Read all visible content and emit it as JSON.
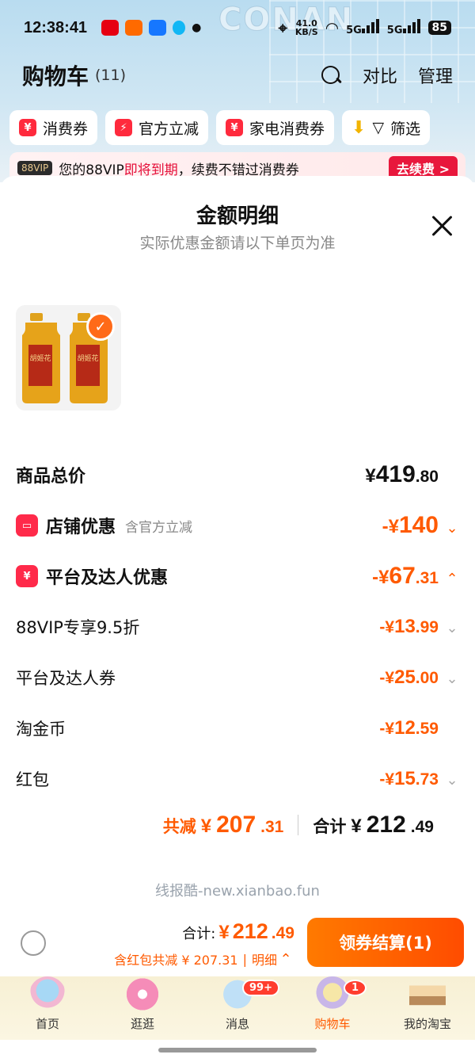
{
  "status_bar": {
    "time": "12:38:41",
    "net_speed_value": "41.0",
    "net_speed_unit": "KB/S",
    "signal_1": "5G",
    "signal_2": "5G",
    "battery": "85"
  },
  "header": {
    "title": "购物车",
    "count": "(11)",
    "compare_label": "对比",
    "manage_label": "管理",
    "decor_text": "CONAN"
  },
  "filters": [
    {
      "label": "消费券",
      "icon": "coupon-icon",
      "icon_glyph": "¥"
    },
    {
      "label": "官方立减",
      "icon": "lightning-icon",
      "icon_glyph": "⚡"
    },
    {
      "label": "家电消费券",
      "icon": "coupon-icon",
      "icon_glyph": "¥"
    },
    {
      "label": "筛选",
      "icon": "filter-icon",
      "icon_glyph": "▽"
    }
  ],
  "vip_banner": {
    "badge": "88VIP",
    "text_prefix": "您的88VIP",
    "text_highlight": "即将到期",
    "text_suffix": "，续费不错过消费券",
    "button": "去续费 >"
  },
  "sheet": {
    "title": "金额明细",
    "subtitle": "实际优惠金额请以下单页为准",
    "product_brand": "胡姬花"
  },
  "breakdown": {
    "total": {
      "label": "商品总价",
      "currency": "¥",
      "int": "419",
      "dec": ".80"
    },
    "store": {
      "label": "店铺优惠",
      "note": "含官方立减",
      "prefix": "-¥",
      "int": "140",
      "dec": ""
    },
    "platform": {
      "label": "平台及达人优惠",
      "prefix": "-¥",
      "int": "67",
      "dec": ".31"
    },
    "items": [
      {
        "label": "88VIP专享9.5折",
        "prefix": "-¥",
        "int": "13",
        "dec": ".99",
        "expandable": true
      },
      {
        "label": "平台及达人券",
        "prefix": "-¥",
        "int": "25",
        "dec": ".00",
        "expandable": true
      },
      {
        "label": "淘金币",
        "prefix": "-¥",
        "int": "12",
        "dec": ".59",
        "expandable": false
      },
      {
        "label": "红包",
        "prefix": "-¥",
        "int": "15",
        "dec": ".73",
        "expandable": true
      }
    ],
    "saved": {
      "label": "共减",
      "currency": "¥",
      "int": "207",
      "dec": ".31"
    },
    "sum": {
      "label": "合计",
      "currency": "¥",
      "int": "212",
      "dec": ".49"
    }
  },
  "watermark": "线报酷-new.xianbao.fun",
  "checkout": {
    "total_label": "合计:",
    "currency": "¥",
    "int": "212",
    "dec": ".49",
    "sub_text": "含红包共减 ¥ 207.31",
    "sep": "|",
    "detail_label": "明细",
    "button": "领券结算(1)"
  },
  "tabs": [
    {
      "label": "首页",
      "active": false,
      "badge": ""
    },
    {
      "label": "逛逛",
      "active": false,
      "badge": ""
    },
    {
      "label": "消息",
      "active": false,
      "badge": "99+"
    },
    {
      "label": "购物车",
      "active": true,
      "badge": "1"
    },
    {
      "label": "我的淘宝",
      "active": false,
      "badge": ""
    }
  ],
  "colors": {
    "accent": "#ff5a00",
    "brand_red": "#ff2a4a",
    "checkout_gradient_start": "#ff7a00",
    "checkout_gradient_end": "#ff4c00"
  }
}
